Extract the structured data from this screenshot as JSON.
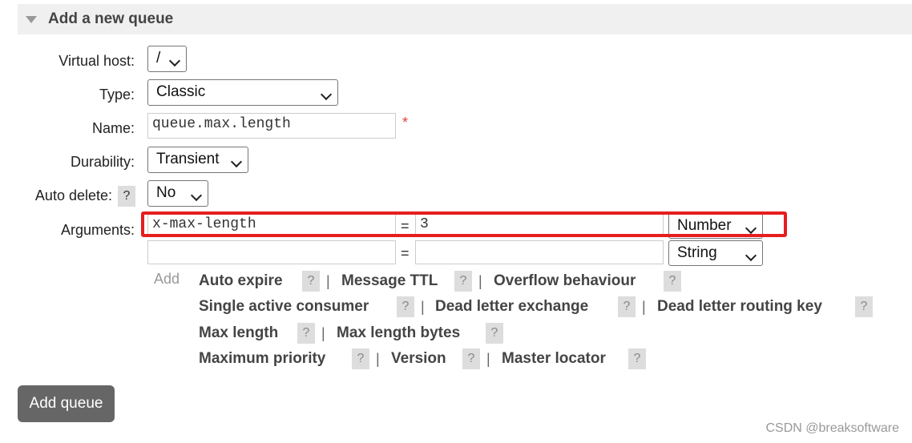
{
  "section": {
    "title": "Add a new queue"
  },
  "form": {
    "vhost_label": "Virtual host:",
    "vhost_value": "/",
    "type_label": "Type:",
    "type_value": "Classic",
    "name_label": "Name:",
    "name_value": "queue.max.length",
    "required_mark": "*",
    "durability_label": "Durability:",
    "durability_value": "Transient",
    "autodelete_label": "Auto delete:",
    "autodelete_help": "?",
    "autodelete_value": "No",
    "arguments_label": "Arguments:",
    "arguments": [
      {
        "key": "x-max-length",
        "eq": "=",
        "value": "3",
        "type": "Number"
      },
      {
        "key": "",
        "eq": "=",
        "value": "",
        "type": "String"
      }
    ],
    "add_label": "Add"
  },
  "shortcuts": [
    {
      "label": "Auto expire",
      "help": "?"
    },
    {
      "label": "Message TTL",
      "help": "?"
    },
    {
      "label": "Overflow behaviour",
      "help": "?"
    },
    {
      "label": "Single active consumer",
      "help": "?"
    },
    {
      "label": "Dead letter exchange",
      "help": "?"
    },
    {
      "label": "Dead letter routing key",
      "help": "?"
    },
    {
      "label": "Max length",
      "help": "?"
    },
    {
      "label": "Max length bytes",
      "help": "?"
    },
    {
      "label": "Maximum priority",
      "help": "?"
    },
    {
      "label": "Version",
      "help": "?"
    },
    {
      "label": "Master locator",
      "help": "?"
    }
  ],
  "separator": "|",
  "button": {
    "add_queue": "Add queue"
  },
  "watermark": "CSDN @breaksoftware",
  "colors": {
    "highlight": "#e61e1e",
    "button_bg": "#666666",
    "header_bg": "#f0f0f0"
  }
}
